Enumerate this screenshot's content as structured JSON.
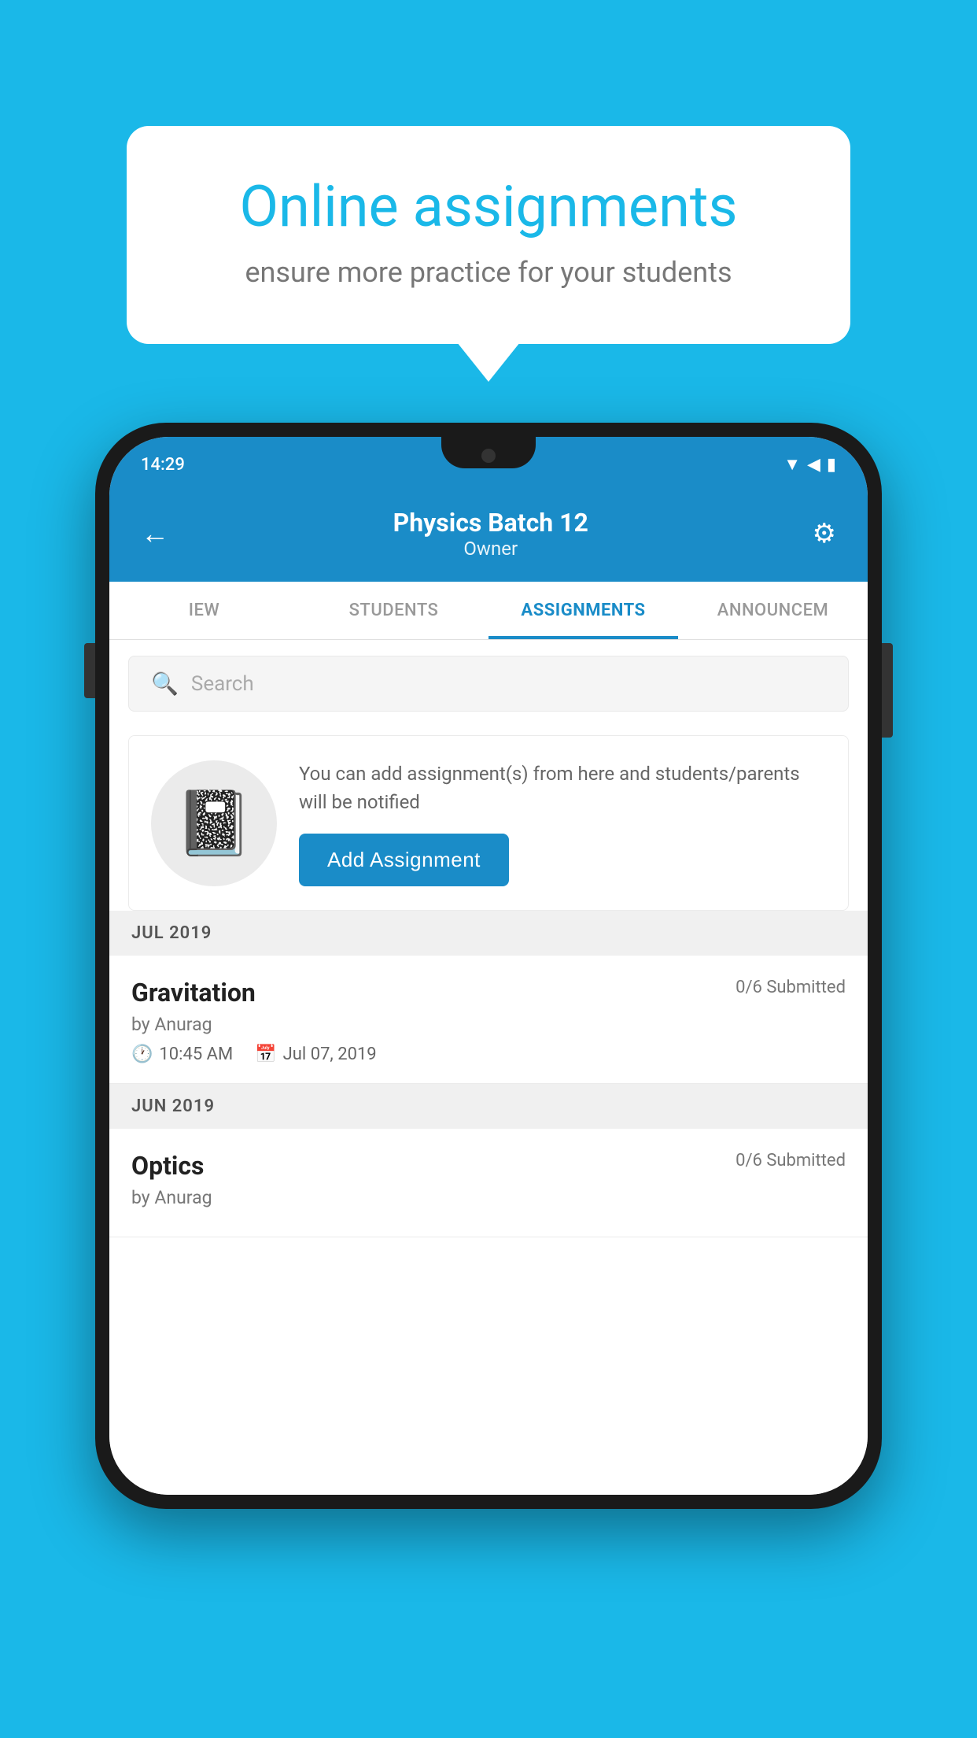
{
  "background_color": "#1ab8e8",
  "speech_bubble": {
    "title": "Online assignments",
    "subtitle": "ensure more practice for your students"
  },
  "phone": {
    "status_bar": {
      "time": "14:29",
      "wifi": "▼",
      "signal": "▲",
      "battery": "▮"
    },
    "header": {
      "title": "Physics Batch 12",
      "subtitle": "Owner",
      "back_label": "←",
      "settings_label": "⚙"
    },
    "tabs": [
      {
        "label": "IEW",
        "active": false
      },
      {
        "label": "STUDENTS",
        "active": false
      },
      {
        "label": "ASSIGNMENTS",
        "active": true
      },
      {
        "label": "ANNOUNCEM",
        "active": false
      }
    ],
    "search": {
      "placeholder": "Search"
    },
    "empty_state": {
      "description": "You can add assignment(s) from here and students/parents will be notified",
      "button_label": "Add Assignment"
    },
    "sections": [
      {
        "month_label": "JUL 2019",
        "assignments": [
          {
            "name": "Gravitation",
            "submitted": "0/6 Submitted",
            "by": "by Anurag",
            "time": "10:45 AM",
            "date": "Jul 07, 2019"
          }
        ]
      },
      {
        "month_label": "JUN 2019",
        "assignments": [
          {
            "name": "Optics",
            "submitted": "0/6 Submitted",
            "by": "by Anurag",
            "time": "",
            "date": ""
          }
        ]
      }
    ]
  }
}
